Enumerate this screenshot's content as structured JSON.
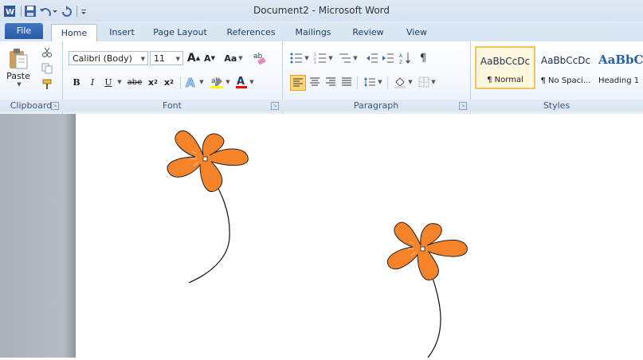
{
  "title_bar": {
    "document_title": "Document2 - Microsoft Word"
  },
  "quick_access": {
    "icons": [
      "word-app-icon",
      "save-icon",
      "undo-icon",
      "redo-icon",
      "customize-qat-icon"
    ]
  },
  "tabs": [
    "File",
    "Home",
    "Insert",
    "Page Layout",
    "References",
    "Mailings",
    "Review",
    "View"
  ],
  "clipboard": {
    "paste_label": "Paste",
    "group_label": "Clipboard"
  },
  "font": {
    "name": "Calibri (Body)",
    "size": "11",
    "change_case": "Aa",
    "bold": "B",
    "italic": "I",
    "underline": "U",
    "strikethrough": "abe",
    "subscript": "x",
    "superscript": "x",
    "group_label": "Font"
  },
  "paragraph": {
    "group_label": "Paragraph",
    "pilcrow": "¶"
  },
  "styles": {
    "group_label": "Styles",
    "items": [
      {
        "sample": "AaBbCcDc",
        "name": "¶ Normal"
      },
      {
        "sample": "AaBbCcDc",
        "name": "¶ No Spaci..."
      },
      {
        "sample": "AaBbC",
        "name": "Heading 1"
      }
    ]
  },
  "colors": {
    "flower_fill": "#f5832a",
    "highlight": "#ffff00",
    "font_color": "#ff0000",
    "file_tab": "#2a5aa5"
  }
}
